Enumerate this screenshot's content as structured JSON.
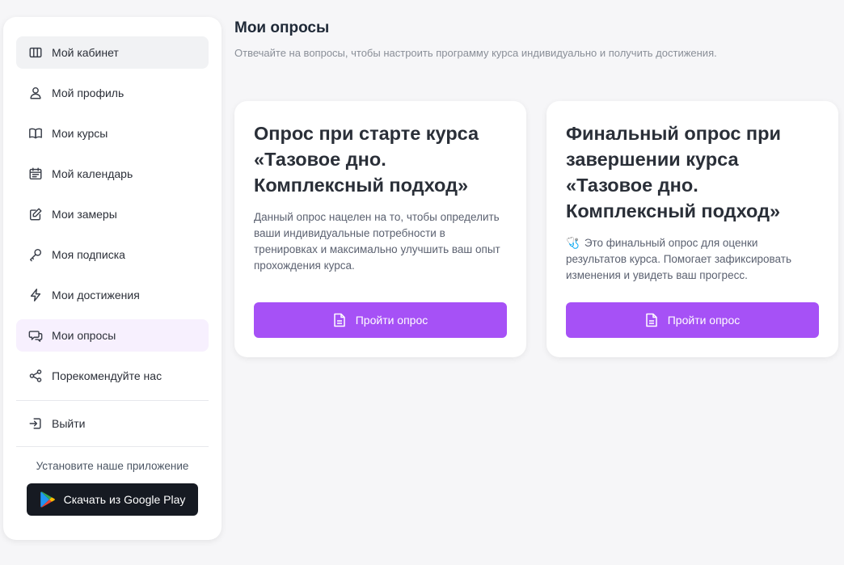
{
  "sidebar": {
    "items": [
      {
        "label": "Мой кабинет",
        "icon": "columns-icon"
      },
      {
        "label": "Мой профиль",
        "icon": "user-icon"
      },
      {
        "label": "Мои курсы",
        "icon": "book-icon"
      },
      {
        "label": "Мой календарь",
        "icon": "calendar-icon"
      },
      {
        "label": "Мои замеры",
        "icon": "edit-icon"
      },
      {
        "label": "Моя подписка",
        "icon": "key-icon"
      },
      {
        "label": "Мои достижения",
        "icon": "lightning-icon"
      },
      {
        "label": "Мои опросы",
        "icon": "chat-icon"
      },
      {
        "label": "Порекомендуйте нас",
        "icon": "share-icon"
      }
    ],
    "logout_label": "Выйти",
    "install_text": "Установите наше приложение",
    "google_play_label": "Скачать из Google Play"
  },
  "main": {
    "title": "Мои опросы",
    "subtitle": "Отвечайте на вопросы, чтобы настроить программу курса индивидуально и получить достижения.",
    "cards": [
      {
        "title": "Опрос при старте курса «Тазовое дно. Комплексный подход»",
        "emoji": "",
        "description": "Данный опрос нацелен на то, чтобы определить ваши индивидуальные потребности в тренировках и максимально улучшить ваш опыт прохождения курса.",
        "button_label": "Пройти опрос"
      },
      {
        "title": "Финальный опрос при завершении курса «Тазовое дно. Комплексный подход»",
        "emoji": "🩺",
        "description": "Это финальный опрос для оценки результатов курса. Помогает зафиксировать изменения и увидеть ваш прогресс.",
        "button_label": "Пройти опрос"
      }
    ]
  },
  "colors": {
    "accent": "#a651f6",
    "active_item_bg": "#f7f0fe",
    "dark_button": "#161a22",
    "background": "#f6f6f8"
  }
}
